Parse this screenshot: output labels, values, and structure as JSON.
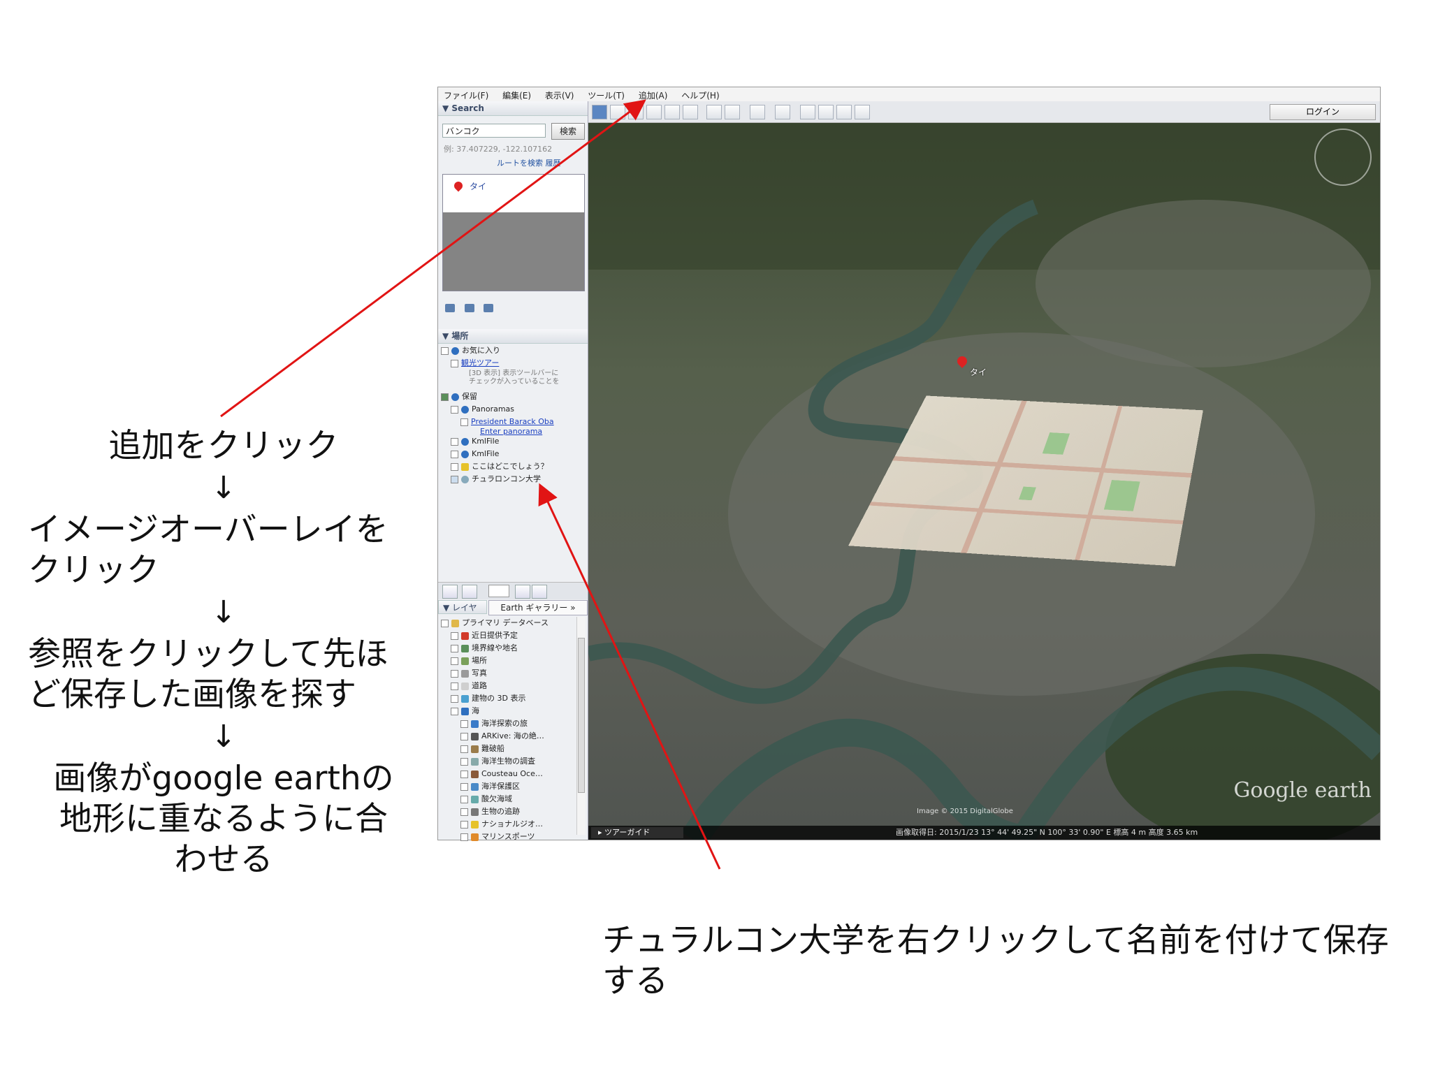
{
  "instructions": {
    "step1": "追加をクリック",
    "arrow": "↓",
    "step2_line1": "イメージオーバーレイを",
    "step2_line2": "クリック",
    "step3_line1": "参照をクリックして先ほ",
    "step3_line2": "ど保存した画像を探す",
    "step4_line1": "画像がgoogle earthの",
    "step4_line2": "地形に重なるように合",
    "step4_line3": "わせる"
  },
  "bottom_note": {
    "line1": "チュラルコン大学を右クリックして名前を付けて保存",
    "line2": "する"
  },
  "app": {
    "menu": [
      "ファイル(F)",
      "編集(E)",
      "表示(V)",
      "ツール(T)",
      "追加(A)",
      "ヘルプ(H)"
    ],
    "login_label": "ログイン",
    "search": {
      "header": "▼ Search",
      "value": "バンコク",
      "button": "検索",
      "hint": "例: 37.407229, -122.107162",
      "routes": "ルートを検索 履歴",
      "result": "タイ"
    },
    "places": {
      "header": "▼ 場所",
      "favorites": "お気に入り",
      "tour": "観光ツアー",
      "tour_note1": "[3D 表示] 表示ツールバーに",
      "tour_note2": "チェックが入っていることを",
      "saved": "保留",
      "panoramas": "Panoramas",
      "obama_1": "President Barack Oba",
      "obama_2": "Enter panorama",
      "kml1": "KmlFile",
      "kml2": "KmlFile",
      "where": "ここはどこでしょう？",
      "univ": "チュラロンコン大学"
    },
    "layers": {
      "tab_layers": "▼ レイヤ",
      "tab_gallery": "Earth ギャラリー »",
      "items": [
        "プライマリ データベース",
        "近日提供予定",
        "境界線や地名",
        "場所",
        "写真",
        "道路",
        "建物の 3D 表示",
        "海",
        "海洋探索の旅",
        "ARKive: 海の絶…",
        "難破船",
        "海洋生物の調査",
        "Cousteau Oce…",
        "海洋保護区",
        "酸欠海域",
        "生物の追跡",
        "ナショナルジオ…",
        "マリンスポーツ"
      ]
    },
    "map": {
      "pin_label": "タイ",
      "logo": "Google earth",
      "tour_guide": "▸ ツアーガイド",
      "status": "画像取得日: 2015/1/23   13° 44' 49.25\" N 100° 33' 0.90\" E  標高  4 m   高度 3.65 km",
      "copyright": "Image © 2015 DigitalGlobe"
    }
  },
  "colors": {
    "arrow": "#e11414",
    "map_base": "#4b5242",
    "link": "#1a3fc0"
  }
}
